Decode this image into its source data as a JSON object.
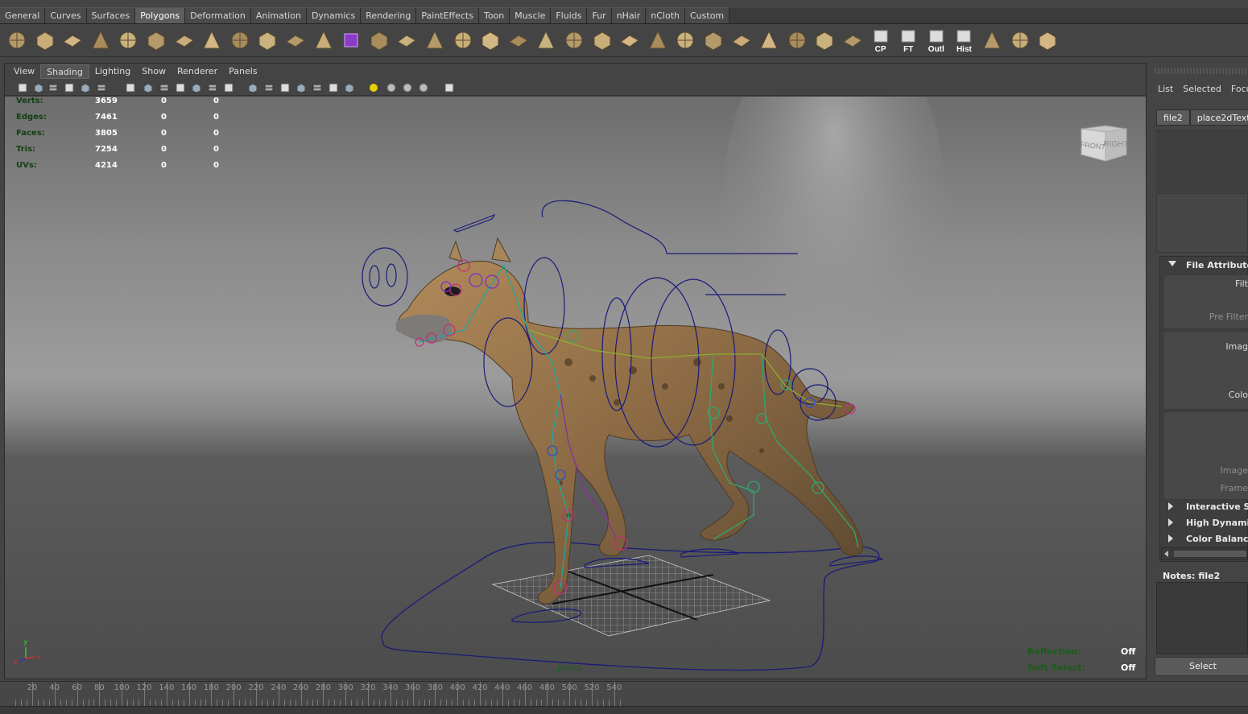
{
  "shelf": {
    "tabs": [
      "General",
      "Curves",
      "Surfaces",
      "Polygons",
      "Deformation",
      "Animation",
      "Dynamics",
      "Rendering",
      "PaintEffects",
      "Toon",
      "Muscle",
      "Fluids",
      "Fur",
      "nHair",
      "nCloth",
      "Custom"
    ],
    "active_tab": "Polygons",
    "icons": [
      {
        "name": "poly-sphere-icon"
      },
      {
        "name": "poly-cube-icon"
      },
      {
        "name": "poly-cylinder-icon"
      },
      {
        "name": "poly-cone-icon"
      },
      {
        "name": "poly-plane-icon"
      },
      {
        "name": "poly-torus-icon"
      },
      {
        "name": "poly-pyramid-icon"
      },
      {
        "name": "poly-pipe-icon"
      },
      {
        "name": "poly-soccer-ball-icon"
      },
      {
        "name": "combine-icon"
      },
      {
        "name": "separate-icon"
      },
      {
        "name": "smooth-icon"
      },
      {
        "name": "uv-cube-icon"
      },
      {
        "name": "select-faces-icon"
      },
      {
        "name": "select-edges-icon"
      },
      {
        "name": "extrude-icon"
      },
      {
        "name": "bridge-icon"
      },
      {
        "name": "append-polygon-icon"
      },
      {
        "name": "split-polygon-icon"
      },
      {
        "name": "insert-edge-loop-icon"
      },
      {
        "name": "merge-icon"
      },
      {
        "name": "bevel-icon"
      },
      {
        "name": "wedge-icon"
      },
      {
        "name": "extract-icon"
      },
      {
        "name": "duplicate-face-icon"
      },
      {
        "name": "sculpt-icon"
      },
      {
        "name": "checker-uv-1-icon"
      },
      {
        "name": "checker-uv-2-icon"
      },
      {
        "name": "checker-uv-3-icon"
      },
      {
        "name": "transfer-icon"
      },
      {
        "name": "texture-editor-icon"
      },
      {
        "name": "center-pivot-icon",
        "label": "CP"
      },
      {
        "name": "freeze-transform-icon",
        "label": "FT"
      },
      {
        "name": "outliner-icon",
        "label": "Outl"
      },
      {
        "name": "history-icon",
        "label": "Hist"
      },
      {
        "name": "mirror-icon"
      },
      {
        "name": "soft-select-icon"
      },
      {
        "name": "uv-layout-icon"
      }
    ]
  },
  "panel_menu": {
    "items": [
      "View",
      "Shading",
      "Lighting",
      "Show",
      "Renderer",
      "Panels"
    ],
    "active": "Shading"
  },
  "heads_up": {
    "stats": [
      {
        "label": "Verts:",
        "values": [
          "3659",
          "0",
          "0"
        ]
      },
      {
        "label": "Edges:",
        "values": [
          "7461",
          "0",
          "0"
        ]
      },
      {
        "label": "Faces:",
        "values": [
          "3805",
          "0",
          "0"
        ]
      },
      {
        "label": "Tris:",
        "values": [
          "7254",
          "0",
          "0"
        ]
      },
      {
        "label": "UVs:",
        "values": [
          "4214",
          "0",
          "0"
        ]
      }
    ],
    "camera": "persp",
    "reflection": {
      "label": "Reflection:",
      "value": "Off"
    },
    "soft_select": {
      "label": "Soft Select:",
      "value": "Off"
    },
    "viewcube": {
      "front": "FRONT",
      "right": "RIGHT"
    },
    "axis": {
      "x": "x",
      "y": "y",
      "z": "z"
    }
  },
  "attribute_editor": {
    "menu": [
      "List",
      "Selected",
      "Focu"
    ],
    "tabs": [
      "file2",
      "place2dText"
    ],
    "sections": [
      {
        "title": "File Attribute",
        "expanded": true
      },
      {
        "title": "Interactive S",
        "expanded": false
      },
      {
        "title": "High Dynamic",
        "expanded": false
      },
      {
        "title": "Color Balance",
        "expanded": false
      }
    ],
    "fields": [
      "Filt",
      "Pre Filter",
      "Imag",
      "Colo",
      "Image",
      "Frame"
    ],
    "notes_label": "Notes:  file2",
    "select_button": "Select"
  },
  "timeline": {
    "ticks": [
      20,
      40,
      60,
      80,
      100,
      120,
      140,
      160,
      180,
      200,
      220,
      240,
      260,
      280,
      300,
      320,
      340,
      360,
      380,
      400,
      420,
      440,
      460,
      480,
      500,
      520,
      540
    ]
  },
  "colors": {
    "ui_bg": "#444444",
    "hud_label": "#123f12",
    "hud_value": "#ffffff",
    "rig_curve": "#1a1a7a"
  }
}
